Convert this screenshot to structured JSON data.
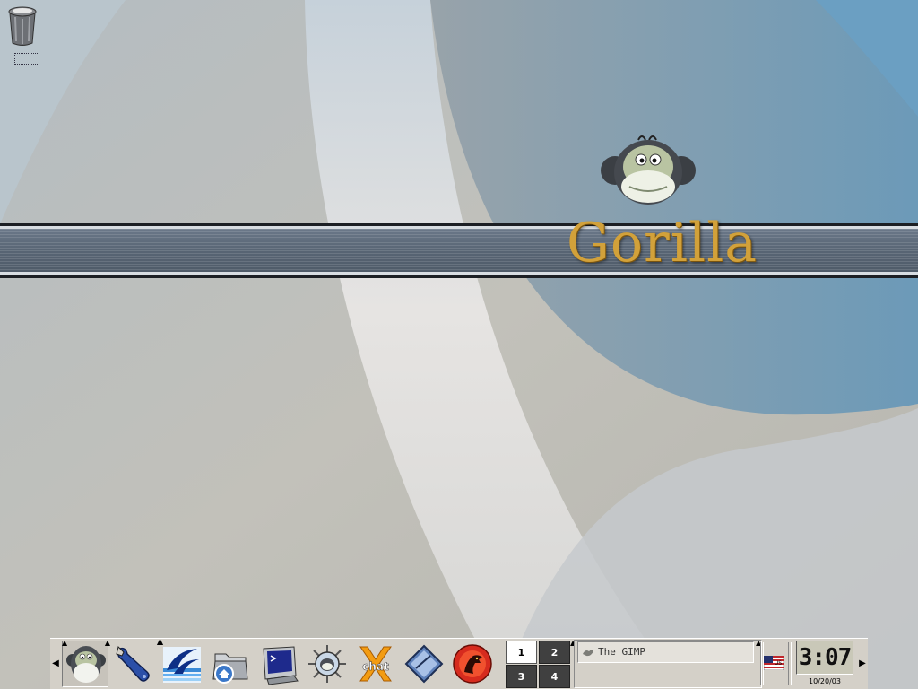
{
  "desktop": {
    "trash_label": "",
    "logo_text": "Gorilla"
  },
  "taskbar": {
    "launchers": [
      {
        "name": "gorilla-menu",
        "icon": "gorilla-icon"
      },
      {
        "name": "settings",
        "icon": "wrench-icon"
      },
      {
        "name": "openoffice",
        "icon": "seagull-icon"
      },
      {
        "name": "home-folder",
        "icon": "home-folder-icon"
      },
      {
        "name": "terminal",
        "icon": "terminal-icon"
      },
      {
        "name": "web-browser",
        "icon": "globe-icon"
      },
      {
        "name": "xchat",
        "icon": "xchat-icon"
      },
      {
        "name": "editor",
        "icon": "diamond-icon"
      },
      {
        "name": "mozilla",
        "icon": "mozilla-icon"
      }
    ],
    "xchat_text": "chat",
    "pager": {
      "desktops": [
        "1",
        "2",
        "3",
        "4"
      ],
      "active": "1"
    },
    "tasks": [
      {
        "label": "The GIMP",
        "icon": "gimp-icon"
      }
    ],
    "keyboard_layout": "US",
    "clock": {
      "time": "3:07",
      "date": "10/20/03"
    }
  },
  "colors": {
    "band": "#5b6878",
    "logo_gold": "#d2a13a",
    "panel": "#d4d0c8"
  }
}
